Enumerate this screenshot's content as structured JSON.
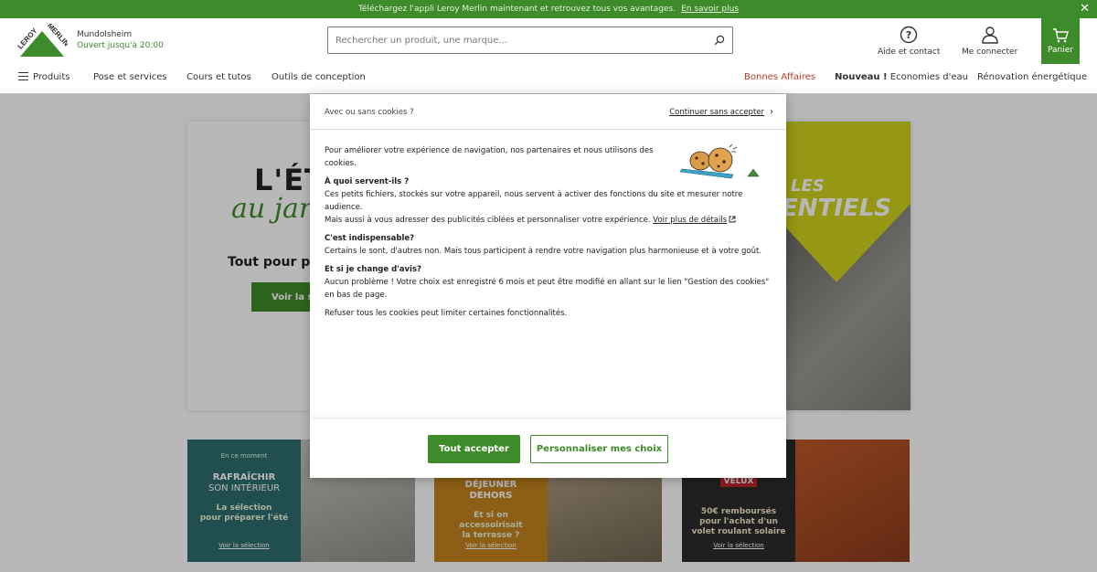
{
  "banner": {
    "text": "Téléchargez l'appli Leroy Merlin maintenant et retrouvez tous vos avantages.",
    "link": "En savoir plus",
    "close_icon": "close-icon"
  },
  "header": {
    "logo_text": "LEROY MERLIN",
    "store_name": "Mundolsheim",
    "store_hours": "Ouvert jusqu'à 20:00",
    "search_placeholder": "Rechercher un produit, une marque...",
    "help_label": "Aide et contact",
    "account_label": "Me connecter",
    "cart_label": "Panier",
    "brand_color": "#3d8b2a"
  },
  "nav": {
    "products": "Produits",
    "services": "Pose et services",
    "courses": "Cours et tutos",
    "tools": "Outils de conception",
    "deals": "Bonnes Affaires",
    "new_prefix": "Nouveau !",
    "new_text": "Economies d'eau",
    "renovation": "Rénovation énergétique"
  },
  "hero": {
    "title": "L'ÉT",
    "script": "au jar",
    "subtitle": "Tout pour pro",
    "button": "Voir la sé",
    "badge_top": "LES",
    "badge_bottom": "ENTIELS"
  },
  "cards": [
    {
      "kicker": "En ce moment",
      "title_1": "RAFRAÎCHIR",
      "title_2": "SON INTÉRIEUR",
      "desc_1": "La sélection",
      "desc_2": "pour préparer l'été",
      "link": "Voir la sélection",
      "color": "#2f6e6e"
    },
    {
      "kicker": "",
      "title_1": "DÉJEUNER",
      "title_2": "DEHORS",
      "desc_1": "Et si on",
      "desc_2": "accessoirisait",
      "desc_3": "la terrasse ?",
      "link": "Voir la sélection",
      "color": "#c4841f"
    },
    {
      "kicker": "VELUX",
      "title_1": "",
      "title_2": "",
      "desc_1": "50€ remboursés",
      "desc_2": "pour l'achat d'un",
      "desc_3": "volet roulant solaire",
      "link": "Voir la sélection",
      "color": "#2b2b2b"
    }
  ],
  "modal": {
    "title": "Avec ou sans cookies ?",
    "continue": "Continuer sans accepter",
    "intro": "Pour améliorer votre expérience de navigation, nos partenaires et nous utilisons des cookies.",
    "q1": "À quoi servent-ils ?",
    "a1_1": "Ces petits fichiers, stockés sur votre appareil, nous servent à activer des fonctions du site et mesurer notre audience.",
    "a1_2": "Mais aussi à vous adresser des publicités ciblées et personnaliser votre expérience.",
    "a1_link": "Voir plus de détails",
    "q2": "C'est indispensable?",
    "a2": "Certains le sont, d'autres non. Mais tous participent à rendre votre navigation plus harmonieuse et à votre goût.",
    "q3": "Et si je change d'avis?",
    "a3": "Aucun problème ! Votre choix est enregistré 6 mois et peut être modifié en allant sur le lien \"Gestion des cookies\" en bas de page.",
    "refuse": "Refuser tous les cookies peut limiter certaines fonctionnalités.",
    "accept_button": "Tout accepter",
    "customize_button": "Personnaliser mes choix"
  }
}
